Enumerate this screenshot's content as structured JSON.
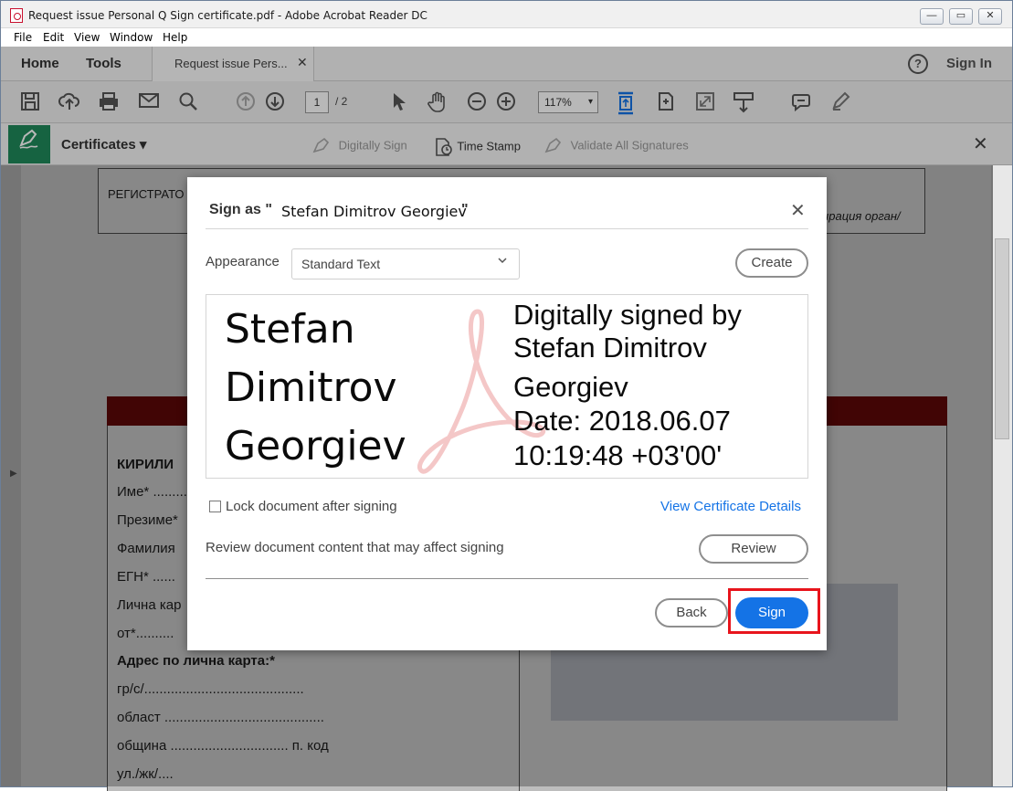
{
  "window": {
    "title": "Request issue Personal Q Sign certificate.pdf - Adobe Acrobat Reader DC",
    "min_label": "—",
    "max_label": "▭",
    "close_label": "✕"
  },
  "menu": [
    "File",
    "Edit",
    "View",
    "Window",
    "Help"
  ],
  "topbar": {
    "home": "Home",
    "tools": "Tools",
    "doc_tab": "Request issue Pers...",
    "doc_tab_close": "✕",
    "help": "?",
    "signin": "Sign In"
  },
  "toolbar": {
    "page_current": "1",
    "page_total": "/ 2",
    "zoom": "117%"
  },
  "certbar": {
    "label": "Certificates ▾",
    "digitally_sign": "Digitally Sign",
    "time_stamp": "Time Stamp",
    "validate": "Validate All Signatures",
    "close": "✕"
  },
  "document": {
    "reg_text": "РЕГИСТРАТО",
    "org_text": "ирация орган/",
    "kirilica": "КИРИЛИ",
    "ime": "Име* .........",
    "prezime": "Презиме*",
    "familia": "Фамилия",
    "egn": "ЕГН* ......",
    "lichna": "Лична кар",
    "ot": "от*..........",
    "adres": "Адрес по лична карта:*",
    "gr": "гр/с/..........................................",
    "oblast": "област ..........................................",
    "obshtina": "община  ............................... п. код",
    "ul": "ул./жк/...."
  },
  "dialog": {
    "title": "Sign as \"",
    "signer": "Stefan Dimitrov Georgiev",
    "title_end": "\"",
    "close": "✕",
    "appearance_label": "Appearance",
    "appearance_value": "Standard Text",
    "create": "Create",
    "preview": {
      "name_lines": [
        "Stefan",
        "Dimitrov",
        "Georgiev"
      ],
      "info_lines": [
        "Digitally signed by",
        "Stefan Dimitrov",
        "Georgiev",
        "Date: 2018.06.07",
        "10:19:48 +03'00'"
      ]
    },
    "lock_label": "Lock document after signing",
    "lock_checked": false,
    "view_cert": "View Certificate Details",
    "review_text": "Review document content that may affect signing",
    "review": "Review",
    "back": "Back",
    "sign": "Sign"
  },
  "colors": {
    "accent": "#1473e6",
    "cert_green": "#1f8a5b",
    "highlight_red": "#e8141c"
  }
}
